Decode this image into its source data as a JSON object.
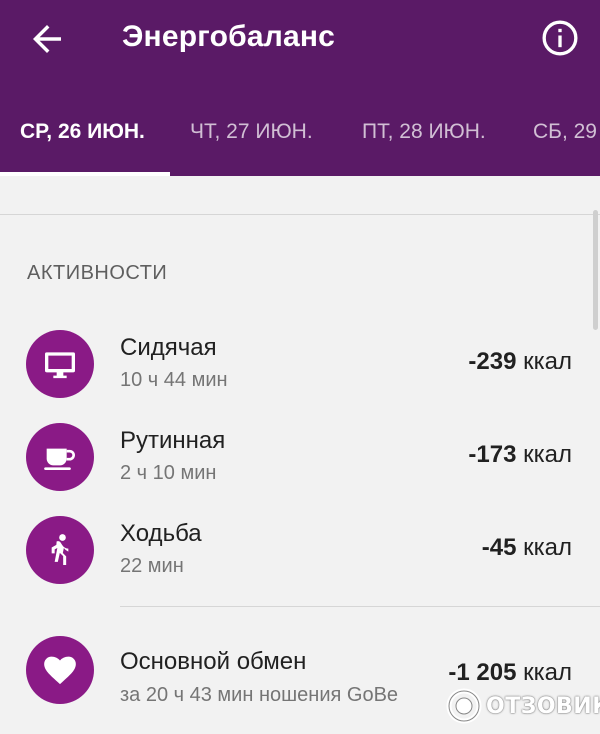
{
  "app_bar": {
    "title": "Энергобаланс",
    "back_icon": "arrow-left-icon",
    "info_icon": "info-icon",
    "background": "#5a1a66"
  },
  "tabs": [
    {
      "label": "СР, 26 ИЮН.",
      "active": true
    },
    {
      "label": "ЧТ, 27 ИЮН.",
      "active": false
    },
    {
      "label": "ПТ, 28 ИЮН.",
      "active": false
    },
    {
      "label": "СБ, 29",
      "active": false
    }
  ],
  "activities": {
    "section_title": "АКТИВНОСТИ",
    "accent_color": "#8a1a86",
    "items": [
      {
        "name": "Сидячая",
        "duration": "10 ч 44 мин",
        "value": "-239",
        "unit": "ккал",
        "icon": "monitor-icon"
      },
      {
        "name": "Рутинная",
        "duration": "2 ч 10 мин",
        "value": "-173",
        "unit": "ккал",
        "icon": "coffee-cup-icon"
      },
      {
        "name": "Ходьба",
        "duration": "22 мин",
        "value": "-45",
        "unit": "ккал",
        "icon": "walking-person-icon"
      }
    ]
  },
  "basal": {
    "name": "Основной обмен",
    "duration": "за 20 ч 43 мин ношения GoBe",
    "value": "-1 205",
    "unit": "ккал",
    "icon": "heart-icon"
  },
  "watermark": {
    "text": "ОТЗОВИК"
  }
}
